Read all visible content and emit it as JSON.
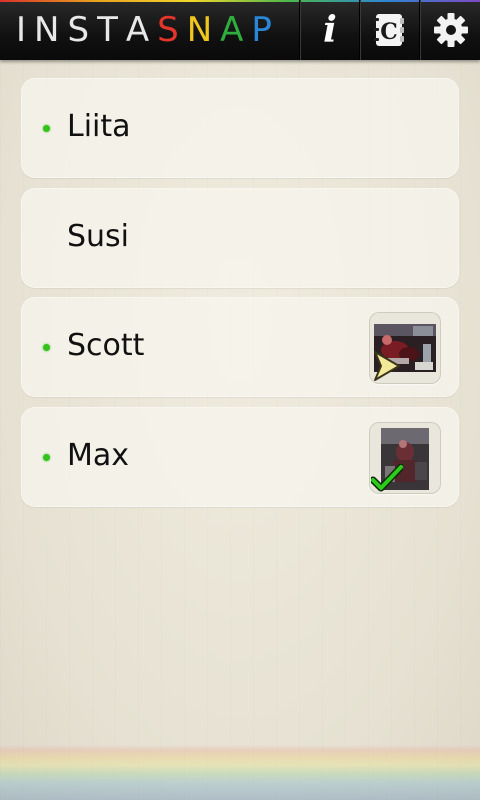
{
  "app": {
    "logo_letters": [
      {
        "ch": "I",
        "color": "#e8e8e8"
      },
      {
        "ch": "N",
        "color": "#e8e8e8"
      },
      {
        "ch": "S",
        "color": "#e8e8e8"
      },
      {
        "ch": "T",
        "color": "#e8e8e8"
      },
      {
        "ch": "A",
        "color": "#e8e8e8"
      },
      {
        "ch": "S",
        "color": "#e4352c"
      },
      {
        "ch": "N",
        "color": "#f0c71d"
      },
      {
        "ch": "A",
        "color": "#2fae3e"
      },
      {
        "ch": "P",
        "color": "#2a86d6"
      }
    ]
  },
  "toolbar": {
    "info_icon": "info-icon",
    "contacts_icon": "contacts-book-icon",
    "settings_icon": "gear-icon"
  },
  "friends": [
    {
      "name": "Liita",
      "online": true,
      "snap": null
    },
    {
      "name": "Susi",
      "online": false,
      "snap": null
    },
    {
      "name": "Scott",
      "online": true,
      "snap": "sent"
    },
    {
      "name": "Max",
      "online": true,
      "snap": "received"
    }
  ],
  "colors": {
    "online_dot": "#35c21c",
    "sent_arrow": "#f2ea9a",
    "received_check": "#2ecc1a"
  }
}
